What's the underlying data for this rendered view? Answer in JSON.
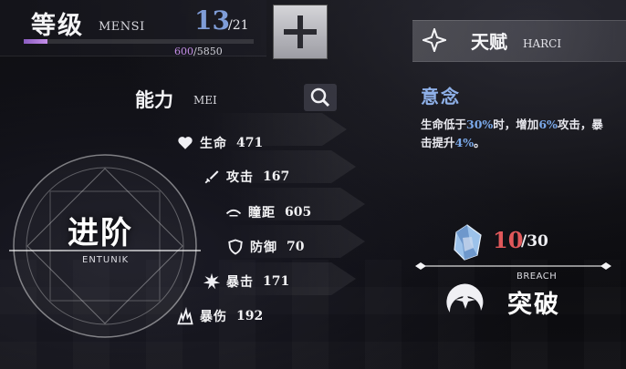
{
  "level": {
    "title": "等级",
    "subtitle": "MENSI",
    "current": "13",
    "max": "/21",
    "xp_current": "600",
    "xp_total": "/5850",
    "xp_fraction": 0.1026
  },
  "ability": {
    "title": "能力",
    "subtitle": "MEI",
    "stats": [
      {
        "name": "生命",
        "value": "471",
        "icon": "heart-icon"
      },
      {
        "name": "攻击",
        "value": "167",
        "icon": "sword-icon"
      },
      {
        "name": "瞳距",
        "value": "605",
        "icon": "eye-icon"
      },
      {
        "name": "防御",
        "value": "70",
        "icon": "shield-icon"
      },
      {
        "name": "暴击",
        "value": "171",
        "icon": "burst-icon"
      },
      {
        "name": "暴伤",
        "value": "192",
        "icon": "flame-icon"
      }
    ]
  },
  "advance": {
    "title": "进阶",
    "subtitle": "ENTUNIK"
  },
  "talent": {
    "title": "天赋",
    "subtitle": "HARCI",
    "skill_name": "意念",
    "desc_parts": [
      "生命低于",
      "30%",
      "时，增加",
      "6%",
      "攻击，暴击提升",
      "4%",
      "。"
    ]
  },
  "breach": {
    "count": "10",
    "max": "/30",
    "small_label": "BREACH",
    "title": "突破"
  },
  "colors": {
    "accent_blue": "#7f9dd8",
    "xp_purple": "#c58ee8",
    "breach_red": "#e0585a",
    "highlight": "#7aa8e8"
  }
}
